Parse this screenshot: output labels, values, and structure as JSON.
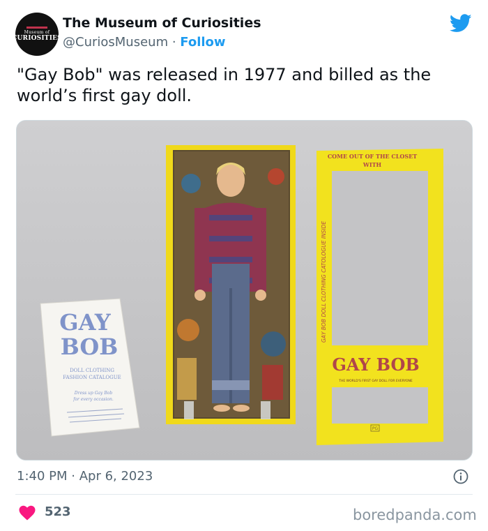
{
  "account": {
    "display_name": "The Museum of Curiosities",
    "handle": "@CuriosMuseum",
    "separator": " · ",
    "follow_label": "Follow",
    "avatar_text_small": "Museum of",
    "avatar_text_big": "CURIOSITIES"
  },
  "tweet": {
    "text": "\"Gay Bob\" was released in 1977 and billed as the world’s first gay doll.",
    "time": "1:40 PM",
    "date_separator": " · ",
    "date": "Apr 6, 2023",
    "like_count": "523"
  },
  "media": {
    "box_top_text_1": "COME OUT OF THE CLOSET",
    "box_top_text_2": "WITH",
    "box_side_text": "GAY BOB DOLL CLOTHING CATOLOGUE INSIDE",
    "box_logo": "GAY BOB",
    "box_tagline": "THE WORLD'S FIRST GAY DOLL FOR EVERYONE",
    "box_rating": "PG",
    "catalog_title_1": "GAY",
    "catalog_title_2": "BOB",
    "catalog_sub_1": "DOLL CLOTHING",
    "catalog_sub_2": "FASHION CATALOGUE",
    "catalog_script_1": "Dress up Gay Bob",
    "catalog_script_2": "for every occasion."
  },
  "watermark": "boredpanda.com",
  "colors": {
    "accent_blue": "#1d9bf0",
    "like_pink": "#f91880",
    "box_yellow": "#f2e21e"
  },
  "icons": [
    "twitter-bird-icon",
    "info-icon",
    "heart-icon"
  ]
}
